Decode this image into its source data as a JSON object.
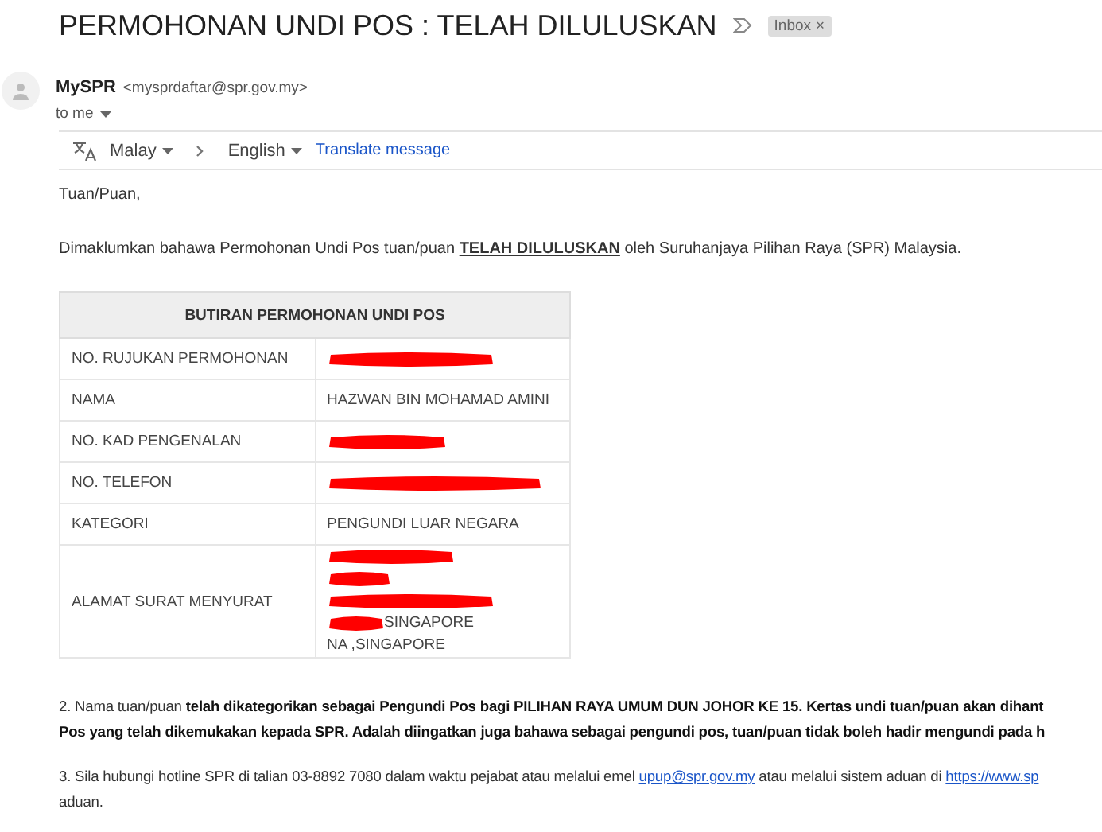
{
  "email": {
    "subject": "PERMOHONAN UNDI POS : TELAH DILULUSKAN",
    "label": {
      "text": "Inbox",
      "close": "×"
    },
    "sender": {
      "name": "MySPR",
      "address": "<mysprdaftar@spr.gov.my>",
      "recipient": "to me"
    },
    "translate": {
      "from": "Malay",
      "to": "English",
      "action": "Translate message"
    }
  },
  "greeting": "Tuan/Puan,",
  "intro": [
    {
      "kind": "plain",
      "text": "Dimaklumkan bahawa Permohonan Undi Pos tuan/puan "
    },
    {
      "kind": "emphasis",
      "text": "TELAH DILULUSKAN"
    },
    {
      "kind": "plain",
      "text": " oleh Suruhanjaya Pilihan Raya (SPR) Malaysia."
    }
  ],
  "table": {
    "title": "BUTIRAN PERMOHONAN UNDI POS",
    "rows": [
      {
        "label": "NO. RUJUKAN PERMOHONAN",
        "lines": [
          {
            "redacted": true
          }
        ]
      },
      {
        "label": "NAMA",
        "lines": [
          {
            "text": "HAZWAN BIN MOHAMAD AMINI",
            "redacted": false
          }
        ]
      },
      {
        "label": "NO. KAD PENGENALAN",
        "lines": [
          {
            "redacted": true
          }
        ]
      },
      {
        "label": "NO. TELEFON",
        "lines": [
          {
            "redacted": true
          }
        ]
      },
      {
        "label": "KATEGORI",
        "lines": [
          {
            "text": "PENGUNDI LUAR NEGARA",
            "redacted": false
          }
        ]
      },
      {
        "label": "ALAMAT SURAT MENYURAT",
        "lines": [
          {
            "redacted": true
          },
          {
            "redacted": true
          },
          {
            "redacted": true
          },
          {
            "text": "SINGAPORE",
            "redacted": true
          },
          {
            "text": "NA ,SINGAPORE",
            "redacted": false
          }
        ]
      }
    ]
  },
  "paragraphs": [
    {
      "lines": [
        [
          {
            "kind": "plain",
            "text": "2.  Nama tuan/puan "
          },
          {
            "kind": "bold",
            "text": "telah dikategorikan sebagai Pengundi Pos bagi PILIHAN RAYA UMUM DUN JOHOR KE 15. Kertas undi tuan/puan akan dihant"
          }
        ],
        [
          {
            "kind": "bold",
            "text": "Pos yang telah dikemukakan kepada SPR. Adalah diingatkan juga bahawa sebagai pengundi pos, tuan/puan tidak boleh hadir mengundi pada h"
          }
        ]
      ]
    },
    {
      "lines": [
        [
          {
            "kind": "plain",
            "text": "3.  Sila hubungi hotline SPR di talian 03-8892 7080 dalam waktu pejabat atau melalui emel "
          },
          {
            "kind": "link",
            "text": "upup@spr.gov.my"
          },
          {
            "kind": "plain",
            "text": " atau melalui sistem aduan di "
          },
          {
            "kind": "link",
            "text": "https://www.sp"
          }
        ],
        [
          {
            "kind": "plain",
            "text": "aduan."
          }
        ]
      ]
    }
  ]
}
